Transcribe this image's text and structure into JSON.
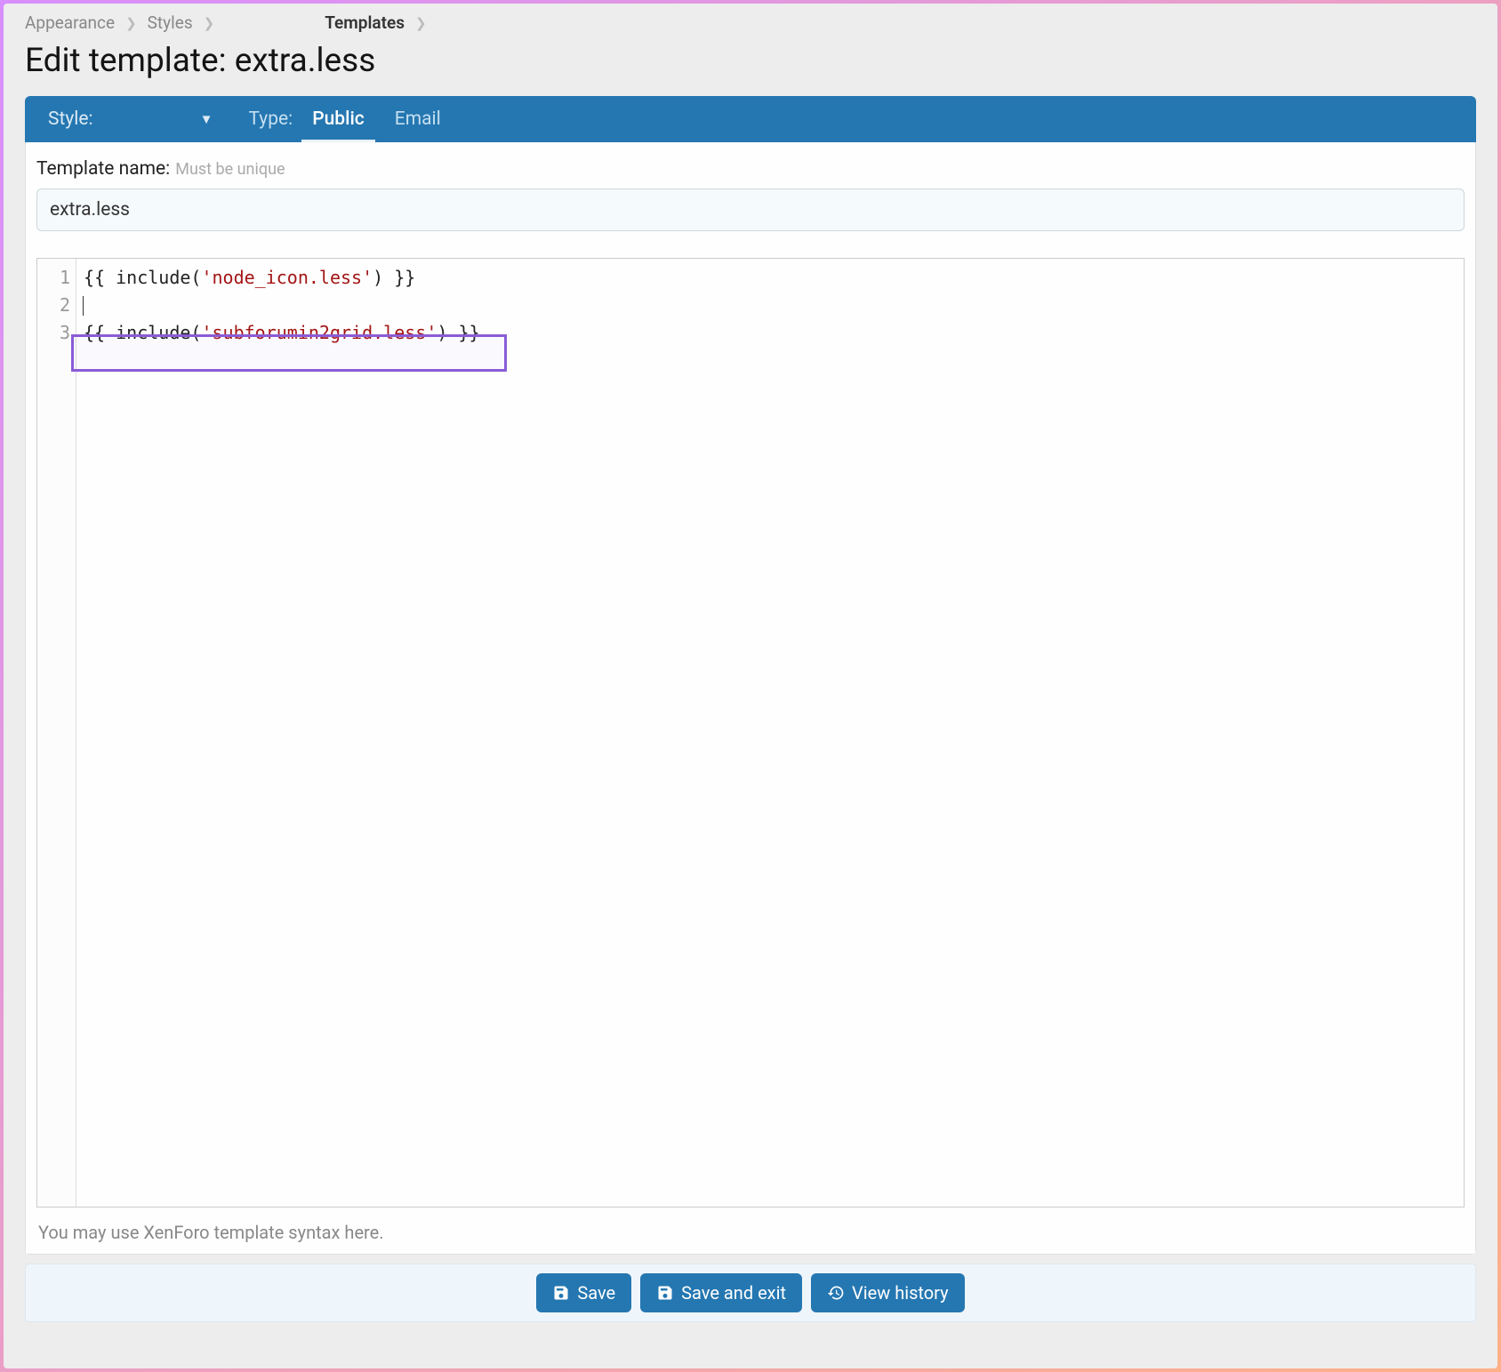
{
  "breadcrumb": {
    "appearance": "Appearance",
    "styles": "Styles",
    "templates": "Templates"
  },
  "page_title": "Edit template: extra.less",
  "tabbar": {
    "style_label": "Style:",
    "type_label": "Type:",
    "tab_public": "Public",
    "tab_email": "Email"
  },
  "field": {
    "label": "Template name:",
    "hint": "Must be unique",
    "value": "extra.less"
  },
  "editor": {
    "lines": [
      "1",
      "2",
      "3"
    ],
    "line1_a": "{{ include(",
    "line1_b": "'node_icon.less'",
    "line1_c": ") }}",
    "line3_a": "{{ include(",
    "line3_b": "'subforumin2grid.less'",
    "line3_c": ") }}"
  },
  "help_text": "You may use XenForo template syntax here.",
  "buttons": {
    "save": "Save",
    "save_exit": "Save and exit",
    "history": "View history"
  }
}
